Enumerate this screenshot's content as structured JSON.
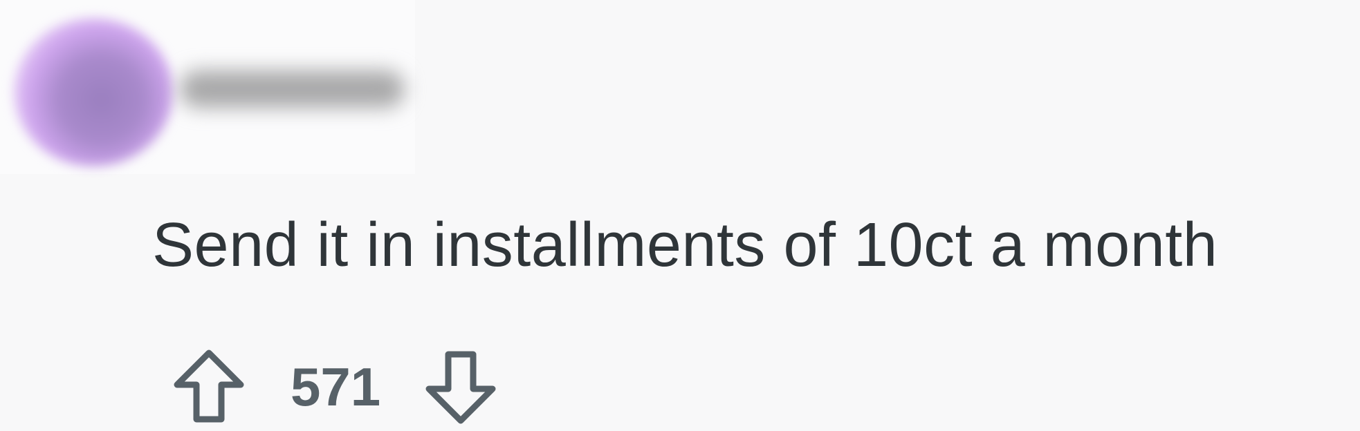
{
  "comment": {
    "author_redacted": true,
    "body": "Send it in installments of 10ct a month",
    "score": "571",
    "upvote_icon": "arrow-up-outline-icon",
    "downvote_icon": "arrow-down-outline-icon"
  },
  "colors": {
    "background": "#f8f8f9",
    "text": "#2f3539",
    "meta": "#576168",
    "avatar": "#a98acc"
  }
}
